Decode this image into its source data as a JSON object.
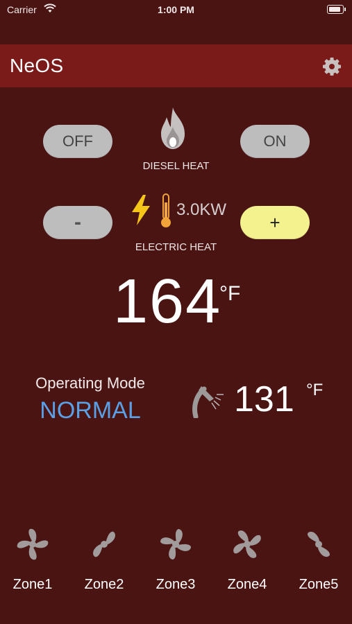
{
  "status": {
    "carrier": "Carrier",
    "time": "1:00 PM"
  },
  "nav": {
    "title": "NeOS",
    "settings_icon": "gear-icon"
  },
  "diesel": {
    "off_label": "OFF",
    "on_label": "ON",
    "label": "DIESEL HEAT",
    "icon": "flame-icon"
  },
  "electric": {
    "minus_label": "-",
    "plus_label": "+",
    "power": "3.0KW",
    "label": "ELECTRIC HEAT",
    "icons": [
      "lightning-icon",
      "thermometer-icon"
    ]
  },
  "main_temp": {
    "value": "164",
    "unit": "°F"
  },
  "operating": {
    "title": "Operating Mode",
    "mode": "NORMAL"
  },
  "water": {
    "value": "131",
    "unit": "°F",
    "icon": "shower-icon"
  },
  "zones": [
    {
      "label": "Zone1"
    },
    {
      "label": "Zone2"
    },
    {
      "label": "Zone3"
    },
    {
      "label": "Zone4"
    },
    {
      "label": "Zone5"
    }
  ],
  "colors": {
    "background": "#4a1413",
    "navbar": "#7a1b1a",
    "pill": "#bdbdbd",
    "pill_active": "#f4f18f",
    "mode_text": "#5aa0e6",
    "lightning": "#f5c518"
  }
}
